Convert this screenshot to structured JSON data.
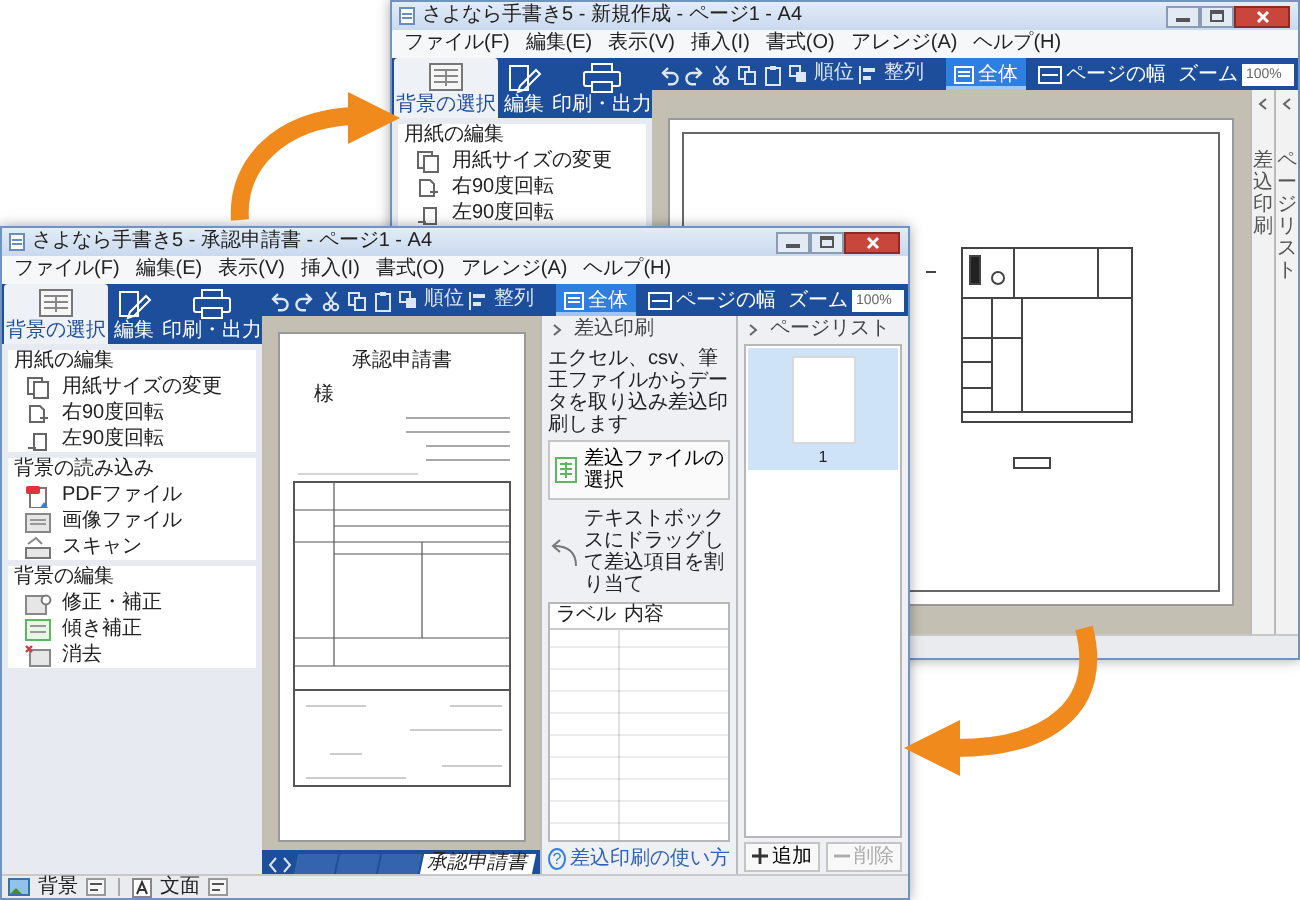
{
  "windows": [
    {
      "title": "さよなら手書き5 - 新規作成 - ページ1 - A4",
      "menu": [
        "ファイル(F)",
        "編集(E)",
        "表示(V)",
        "挿入(I)",
        "書式(O)",
        "アレンジ(A)",
        "ヘルプ(H)"
      ],
      "ribbon_tabs": [
        {
          "label": "背景の選択",
          "kind": "background",
          "selected": true
        },
        {
          "label": "編集",
          "kind": "edit",
          "selected": false
        },
        {
          "label": "印刷・出力",
          "kind": "print",
          "selected": false
        }
      ],
      "tools": [
        {
          "kind": "undo"
        },
        {
          "kind": "redo"
        },
        {
          "kind": "cut"
        },
        {
          "kind": "copy"
        },
        {
          "kind": "paste"
        },
        {
          "kind": "order",
          "label": "順位"
        },
        {
          "kind": "align",
          "label": "整列"
        }
      ],
      "view_tabs": [
        {
          "label": "全体",
          "kind": "whole",
          "selected": true
        },
        {
          "label": "ページの幅",
          "kind": "width",
          "selected": false
        }
      ],
      "zoom": {
        "label": "ズーム",
        "value": "100%"
      },
      "left_panel": [
        {
          "heading": "用紙の編集",
          "items": [
            {
              "label": "用紙サイズの変更",
              "kind": "paper-size"
            },
            {
              "label": "右90度回転",
              "kind": "rotate-right"
            },
            {
              "label": "左90度回転",
              "kind": "rotate-left"
            }
          ]
        }
      ],
      "canvas": {
        "kind": "floor-plan"
      },
      "collapsed_panels": [
        {
          "label": "差込印刷"
        },
        {
          "label": "ページリスト"
        }
      ]
    },
    {
      "title": "さよなら手書き5 - 承認申請書 - ページ1 - A4",
      "menu": [
        "ファイル(F)",
        "編集(E)",
        "表示(V)",
        "挿入(I)",
        "書式(O)",
        "アレンジ(A)",
        "ヘルプ(H)"
      ],
      "ribbon_tabs": [
        {
          "label": "背景の選択",
          "kind": "background",
          "selected": true
        },
        {
          "label": "編集",
          "kind": "edit",
          "selected": false
        },
        {
          "label": "印刷・出力",
          "kind": "print",
          "selected": false
        }
      ],
      "tools": [
        {
          "kind": "undo"
        },
        {
          "kind": "redo"
        },
        {
          "kind": "cut"
        },
        {
          "kind": "copy"
        },
        {
          "kind": "paste"
        },
        {
          "kind": "order",
          "label": "順位"
        },
        {
          "kind": "align",
          "label": "整列"
        }
      ],
      "view_tabs": [
        {
          "label": "全体",
          "kind": "whole",
          "selected": true
        },
        {
          "label": "ページの幅",
          "kind": "width",
          "selected": false
        }
      ],
      "zoom": {
        "label": "ズーム",
        "value": "100%"
      },
      "left_panel": [
        {
          "heading": "用紙の編集",
          "items": [
            {
              "label": "用紙サイズの変更",
              "kind": "paper-size"
            },
            {
              "label": "右90度回転",
              "kind": "rotate-right"
            },
            {
              "label": "左90度回転",
              "kind": "rotate-left"
            }
          ]
        },
        {
          "heading": "背景の読み込み",
          "items": [
            {
              "label": "PDFファイル",
              "kind": "pdf"
            },
            {
              "label": "画像ファイル",
              "kind": "image"
            },
            {
              "label": "スキャン",
              "kind": "scan"
            }
          ]
        },
        {
          "heading": "背景の編集",
          "items": [
            {
              "label": "修正・補正",
              "kind": "correct"
            },
            {
              "label": "傾き補正",
              "kind": "deskew"
            },
            {
              "label": "消去",
              "kind": "erase"
            }
          ]
        }
      ],
      "canvas": {
        "kind": "form",
        "document_title": "承認申請書",
        "addressee": "様"
      },
      "sheet_tabs": [
        {
          "selected": false
        },
        {
          "selected": false
        },
        {
          "selected": false
        },
        {
          "label": "承認申請書",
          "selected": true
        }
      ],
      "merge_panel": {
        "title": "差込印刷",
        "description": "エクセル、csv、筆王ファイルからデータを取り込み差込印刷します",
        "select_button": "差込ファイルの選択",
        "hint": "テキストボックスにドラッグして差込項目を割り当て",
        "columns": [
          "ラベル",
          "内容"
        ],
        "help_icon": "?",
        "help_link": "差込印刷の使い方"
      },
      "page_list": {
        "title": "ページリスト",
        "pages": [
          {
            "label": "1",
            "selected": true
          }
        ],
        "buttons": [
          {
            "label": "追加",
            "kind": "add",
            "disabled": false
          },
          {
            "label": "削除",
            "kind": "remove",
            "disabled": true
          }
        ]
      },
      "status_bar": [
        {
          "label": "背景",
          "kind": "background"
        },
        {
          "label": "文面",
          "kind": "text"
        }
      ]
    }
  ]
}
